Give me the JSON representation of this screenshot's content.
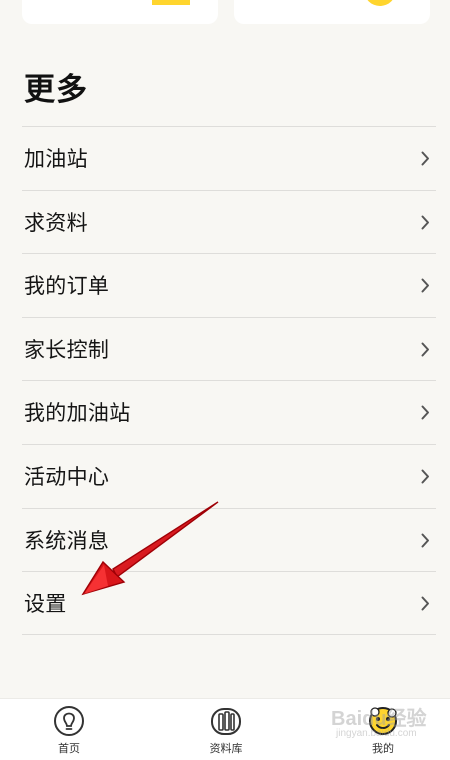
{
  "section": {
    "title": "更多"
  },
  "menu": {
    "items": [
      {
        "label": "加油站"
      },
      {
        "label": "求资料"
      },
      {
        "label": "我的订单"
      },
      {
        "label": "家长控制"
      },
      {
        "label": "我的加油站"
      },
      {
        "label": "活动中心"
      },
      {
        "label": "系统消息"
      },
      {
        "label": "设置"
      }
    ]
  },
  "bottom_nav": {
    "home_label": "首页",
    "library_label": "资料库",
    "mine_label": "我的"
  },
  "watermark": {
    "text": "Baidu经验",
    "subtext": "jingyan.baidu.com"
  },
  "colors": {
    "accent_yellow": "#ffd52e",
    "background": "#f8f7f3",
    "divider": "#deddda",
    "annotation_red": "#c81012"
  }
}
